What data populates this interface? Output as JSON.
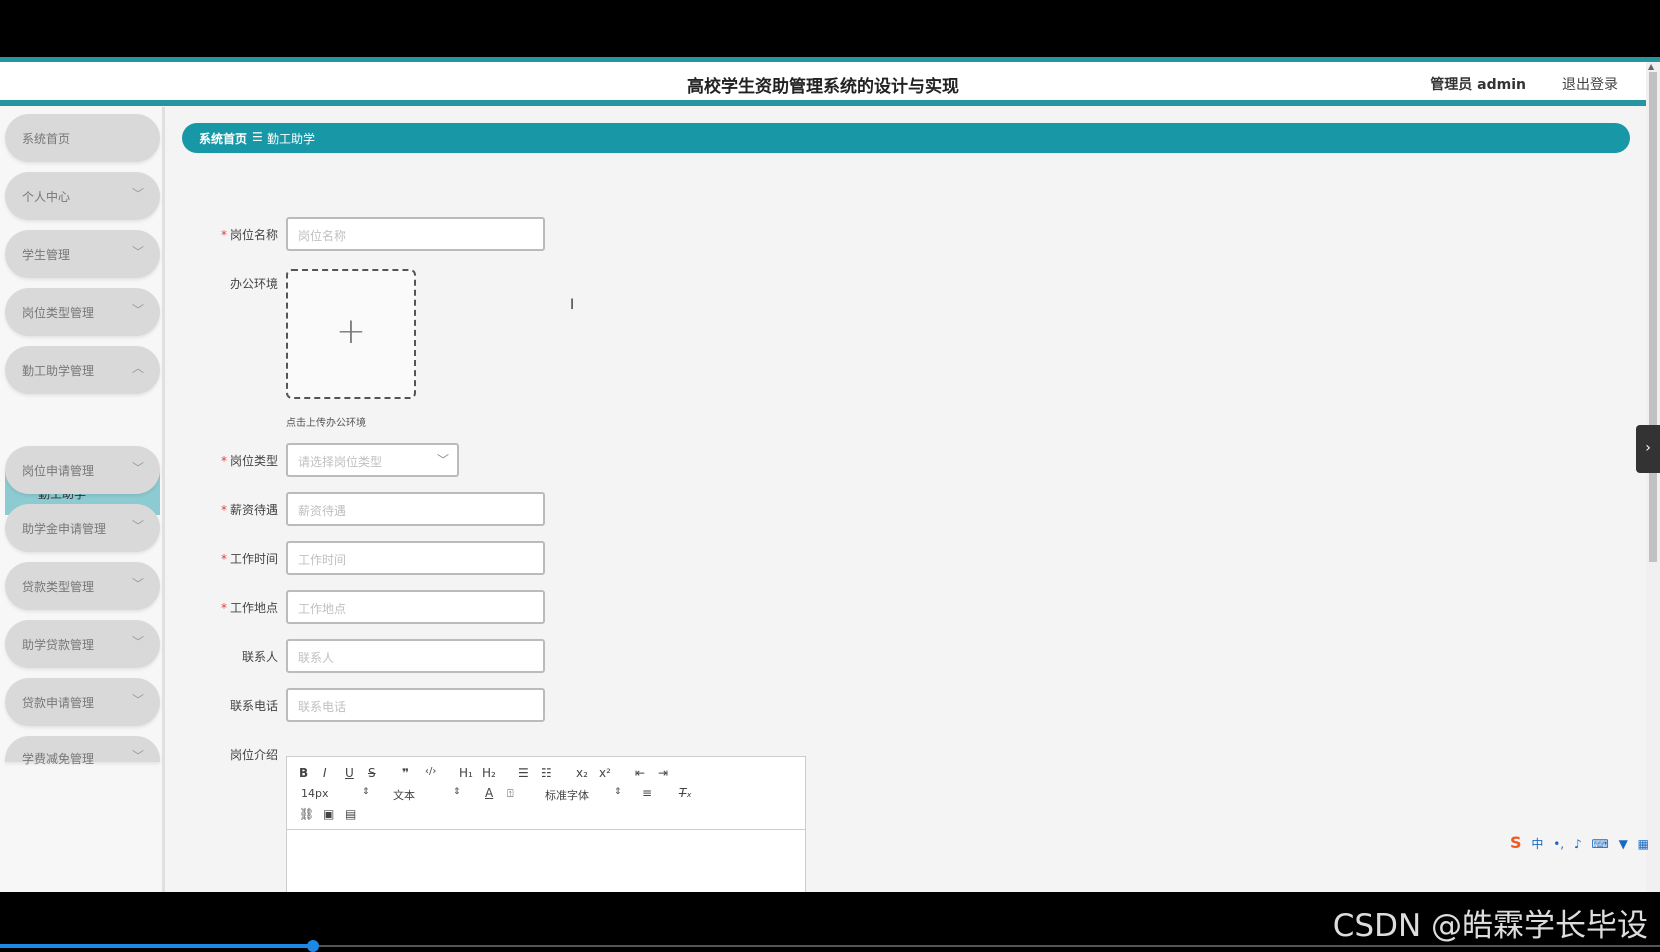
{
  "header": {
    "title": "高校学生资助管理系统的设计与实现",
    "user": "管理员 admin",
    "logout": "退出登录"
  },
  "sidebar": {
    "items": [
      {
        "label": "系统首页"
      },
      {
        "label": "个人中心"
      },
      {
        "label": "学生管理"
      },
      {
        "label": "岗位类型管理"
      },
      {
        "label": "勤工助学管理"
      },
      {
        "label": "岗位申请管理"
      },
      {
        "label": "助学金申请管理"
      },
      {
        "label": "贷款类型管理"
      },
      {
        "label": "助学贷款管理"
      },
      {
        "label": "贷款申请管理"
      },
      {
        "label": "学费减免管理"
      }
    ],
    "subitem": {
      "label": "勤工助学"
    }
  },
  "breadcrumb": {
    "home": "系统首页",
    "separator": "☰",
    "current": "勤工助学"
  },
  "form": {
    "position_name": {
      "label": "岗位名称",
      "placeholder": "岗位名称"
    },
    "office_env": {
      "label": "办公环境",
      "tip": "点击上传办公环境"
    },
    "position_type": {
      "label": "岗位类型",
      "placeholder": "请选择岗位类型"
    },
    "salary": {
      "label": "薪资待遇",
      "placeholder": "薪资待遇"
    },
    "work_time": {
      "label": "工作时间",
      "placeholder": "工作时间"
    },
    "work_place": {
      "label": "工作地点",
      "placeholder": "工作地点"
    },
    "contact": {
      "label": "联系人",
      "placeholder": "联系人"
    },
    "phone": {
      "label": "联系电话",
      "placeholder": "联系电话"
    },
    "intro": {
      "label": "岗位介绍"
    },
    "required_mark": "*"
  },
  "editor": {
    "font_size": "14px",
    "text_style": "文本",
    "font_family": "标准字体"
  },
  "watermark": "CSDN @皓霖学长毕设",
  "colors": {
    "accent": "#1898a6",
    "submenu_active": "#8ccbd1",
    "required": "#e04040"
  }
}
